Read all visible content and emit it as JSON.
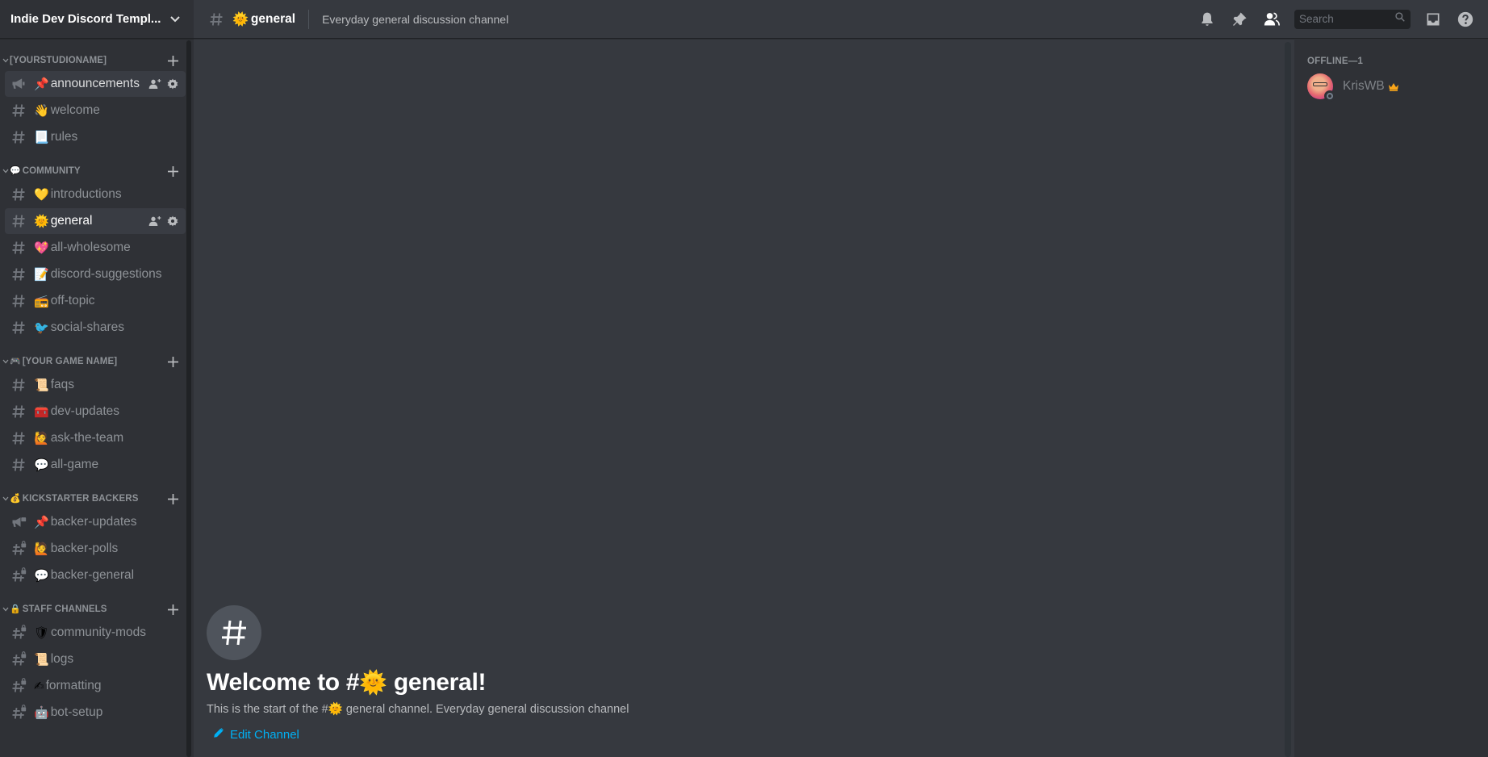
{
  "guild": {
    "name": "Indie Dev Discord Templ..."
  },
  "sidebar": {
    "categories": [
      {
        "emoji": "",
        "name": "[YOURSTUDIONAME]",
        "channels": [
          {
            "type": "announcement",
            "emoji": "📌",
            "name": "announcements",
            "state": "hover"
          },
          {
            "type": "text",
            "emoji": "👋",
            "name": "welcome"
          },
          {
            "type": "text",
            "emoji": "📃",
            "name": "rules"
          }
        ]
      },
      {
        "emoji": "💬",
        "name": "COMMUNITY",
        "channels": [
          {
            "type": "text",
            "emoji": "💛",
            "name": "introductions"
          },
          {
            "type": "text",
            "emoji": "🌞",
            "name": "general",
            "state": "selected"
          },
          {
            "type": "text",
            "emoji": "💖",
            "name": "all-wholesome"
          },
          {
            "type": "text",
            "emoji": "📝",
            "name": "discord-suggestions"
          },
          {
            "type": "text",
            "emoji": "📻",
            "name": "off-topic"
          },
          {
            "type": "text",
            "emoji": "🐦",
            "name": "social-shares"
          }
        ]
      },
      {
        "emoji": "🎮",
        "name": "[YOUR GAME NAME]",
        "channels": [
          {
            "type": "text",
            "emoji": "📜",
            "name": "faqs"
          },
          {
            "type": "text",
            "emoji": "🧰",
            "name": "dev-updates"
          },
          {
            "type": "text",
            "emoji": "🙋",
            "name": "ask-the-team"
          },
          {
            "type": "text",
            "emoji": "💬",
            "name": "all-game"
          }
        ]
      },
      {
        "emoji": "💰",
        "name": "KICKSTARTER BACKERS",
        "channels": [
          {
            "type": "announcement-locked",
            "emoji": "📌",
            "name": "backer-updates"
          },
          {
            "type": "text-locked",
            "emoji": "🙋",
            "name": "backer-polls"
          },
          {
            "type": "text-locked",
            "emoji": "💬",
            "name": "backer-general"
          }
        ]
      },
      {
        "emoji": "🔒",
        "name": "STAFF CHANNELS",
        "channels": [
          {
            "type": "text-locked",
            "emoji": "🛡",
            "name": "community-mods"
          },
          {
            "type": "text-locked",
            "emoji": "📜",
            "name": "logs"
          },
          {
            "type": "text-locked",
            "emoji": "✍",
            "name": "formatting"
          },
          {
            "type": "text-locked",
            "emoji": "🤖",
            "name": "bot-setup"
          }
        ]
      }
    ]
  },
  "header": {
    "channel_emoji": "🌞",
    "channel_name": "general",
    "topic": "Everyday general discussion channel",
    "icons": [
      "bell-icon",
      "pin-icon",
      "members-icon",
      "inbox-icon",
      "help-icon"
    ],
    "search_placeholder": "Search"
  },
  "welcome": {
    "title_prefix": "Welcome to #",
    "emoji": "🌞",
    "title_suffix": "general!",
    "subtitle_prefix": "This is the start of the #",
    "subtitle_suffix": "general channel. Everyday general discussion channel",
    "edit_label": "Edit Channel"
  },
  "members": {
    "groups": [
      {
        "header": "OFFLINE—1",
        "members": [
          {
            "name": "KrisWB",
            "owner": true,
            "status": "offline"
          }
        ]
      }
    ]
  },
  "colors": {
    "accent_link": "#00b0f4",
    "crown": "#faa61a"
  }
}
